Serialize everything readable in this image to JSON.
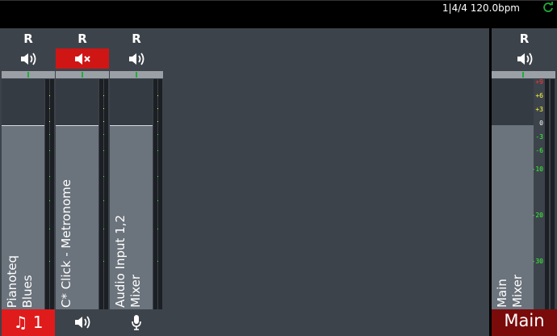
{
  "transport": {
    "position": "1|4/4",
    "tempo": "120.0bpm"
  },
  "colors": {
    "accent_green": "#1fae3a",
    "mute_red": "#d01515",
    "main_red": "#7a0b0b",
    "selected_red": "#e01b1b"
  },
  "strips": [
    {
      "rec_label": "R",
      "muted": false,
      "name": "Pianoteq\nBlues",
      "level": 0.8,
      "bottom_type": "midi",
      "bottom_label": "♫ 1",
      "selected": true
    },
    {
      "rec_label": "R",
      "muted": true,
      "name": "C* Click - Metronome",
      "level": 0.8,
      "bottom_type": "audio-icon",
      "bottom_label": "",
      "selected": false
    },
    {
      "rec_label": "R",
      "muted": false,
      "name": "Audio Input 1,2\nMixer",
      "level": 0.8,
      "bottom_type": "mic-icon",
      "bottom_label": "",
      "selected": false
    }
  ],
  "main": {
    "rec_label": "R",
    "muted": false,
    "name": "Main\nMixer",
    "level": 0.8,
    "bottom_label": "Main"
  },
  "meter_scale": [
    {
      "label": "+9",
      "color": "#ff3333"
    },
    {
      "label": "+6",
      "color": "#ffff33"
    },
    {
      "label": "+3",
      "color": "#ffff33"
    },
    {
      "label": "0",
      "color": "#ffffff"
    },
    {
      "label": "-3",
      "color": "#33ff33"
    },
    {
      "label": "-6",
      "color": "#33ff33"
    },
    {
      "label": "-10",
      "color": "#33ff33"
    },
    {
      "label": "-20",
      "color": "#33ff33"
    },
    {
      "label": "-30",
      "color": "#33ff33"
    }
  ]
}
